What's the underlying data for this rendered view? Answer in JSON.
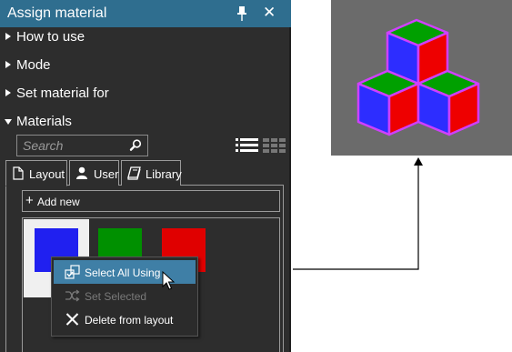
{
  "panel": {
    "title": "Assign material",
    "sections": [
      {
        "label": "How to use",
        "expanded": false
      },
      {
        "label": "Mode",
        "expanded": false
      },
      {
        "label": "Set material for",
        "expanded": false
      },
      {
        "label": "Materials",
        "expanded": true
      }
    ]
  },
  "search": {
    "placeholder": "Search"
  },
  "tabs": [
    {
      "label": "Layout",
      "icon": "document-icon",
      "active": true
    },
    {
      "label": "User",
      "icon": "user-icon",
      "active": false
    },
    {
      "label": "Library",
      "icon": "book-icon",
      "active": false
    }
  ],
  "add_new": {
    "label": "Add new"
  },
  "materials": [
    {
      "color": "#2020f0",
      "selected": true
    },
    {
      "color": "#009000",
      "selected": false
    },
    {
      "color": "#e00000",
      "selected": false
    }
  ],
  "context_menu": {
    "items": [
      {
        "label": "Select All Using",
        "icon": "select-all-icon",
        "highlighted": true,
        "disabled": false
      },
      {
        "label": "Set Selected",
        "icon": "shuffle-icon",
        "highlighted": false,
        "disabled": true
      },
      {
        "label": "Delete from layout",
        "icon": "x-icon",
        "highlighted": false,
        "disabled": false
      }
    ]
  },
  "colors": {
    "titlebar": "#2f6e8f",
    "panel_bg": "#2d2d2d",
    "menu_highlight": "#3f7fa6",
    "preview_bg": "#6b6b6b",
    "cube_top": "#00a000",
    "cube_left": "#2d2dff",
    "cube_right": "#ee0000",
    "cube_outline": "#d040ff"
  }
}
